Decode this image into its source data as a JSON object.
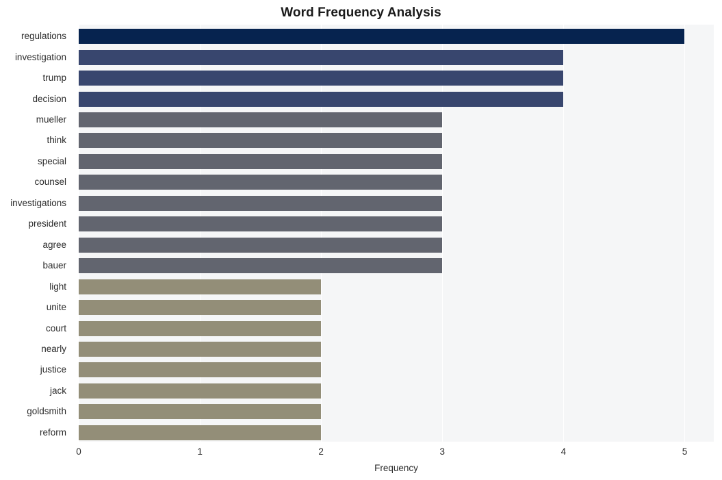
{
  "chart_data": {
    "type": "bar",
    "orientation": "horizontal",
    "title": "Word Frequency Analysis",
    "xlabel": "Frequency",
    "ylabel": "",
    "xlim": [
      0,
      5.24
    ],
    "xticks": [
      0,
      1,
      2,
      3,
      4,
      5
    ],
    "xtick_labels": [
      "0",
      "1",
      "2",
      "3",
      "4",
      "5"
    ],
    "grid": true,
    "grid_axis": "x",
    "legend": null,
    "categories": [
      "regulations",
      "investigation",
      "trump",
      "decision",
      "mueller",
      "think",
      "special",
      "counsel",
      "investigations",
      "president",
      "agree",
      "bauer",
      "light",
      "unite",
      "court",
      "nearly",
      "justice",
      "jack",
      "goldsmith",
      "reform"
    ],
    "values": [
      5,
      4,
      4,
      4,
      3,
      3,
      3,
      3,
      3,
      3,
      3,
      3,
      2,
      2,
      2,
      2,
      2,
      2,
      2,
      2
    ],
    "bar_colors": [
      "#06234f",
      "#38466e",
      "#38466e",
      "#38466e",
      "#62656f",
      "#62656f",
      "#62656f",
      "#62656f",
      "#62656f",
      "#62656f",
      "#62656f",
      "#62656f",
      "#938e78",
      "#938e78",
      "#938e78",
      "#938e78",
      "#938e78",
      "#938e78",
      "#938e78",
      "#938e78"
    ]
  },
  "style": {
    "plot_background": "#f5f6f7",
    "figure_background": "#ffffff",
    "gridline_color": "#ffffff",
    "text_color": "#2b2b2b",
    "title_color": "#1a1a1a"
  }
}
